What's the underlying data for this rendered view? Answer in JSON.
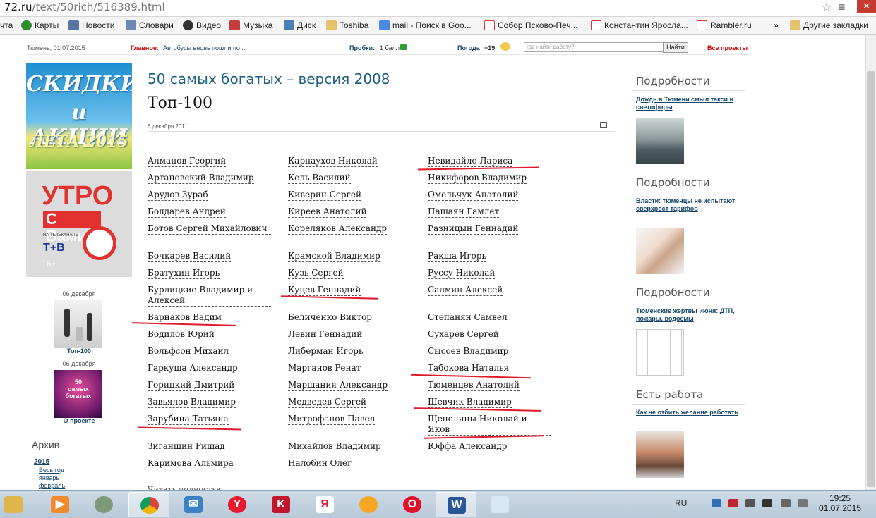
{
  "browser": {
    "url_host": "72.ru",
    "url_path": "/text/50rich/516389.html",
    "bookmarks": [
      {
        "label": "чта",
        "icon": "none"
      },
      {
        "label": "Карты",
        "icon": "maps-icon"
      },
      {
        "label": "Новости",
        "icon": "news-icon"
      },
      {
        "label": "Словари",
        "icon": "dictionary-icon"
      },
      {
        "label": "Видео",
        "icon": "video-icon"
      },
      {
        "label": "Музыка",
        "icon": "music-icon"
      },
      {
        "label": "Диск",
        "icon": "disk-icon"
      },
      {
        "label": "Toshiba",
        "icon": "folder-icon"
      },
      {
        "label": "mail - Поиск в Goo...",
        "icon": "google-icon"
      },
      {
        "label": "Собор Псково-Печ...",
        "icon": "yandex-icon"
      },
      {
        "label": "Константин Яросла...",
        "icon": "yandex-icon"
      },
      {
        "label": "Rambler.ru",
        "icon": "yandex-icon"
      },
      {
        "label": "»",
        "icon": "none"
      },
      {
        "label": "Другие закладки",
        "icon": "folder-icon"
      }
    ]
  },
  "topstrip": {
    "location_date": "Тюмень, 01.07.2015",
    "main_label": "Главное:",
    "main_link": "Автобусы вновь пошли по ...",
    "traffic_label": "Пробки:",
    "traffic_value": "1 балл",
    "weather_label": "Погода",
    "weather_value": "+19",
    "search_placeholder": "где найти работу?",
    "search_button": "Найти",
    "all_projects": "Все проекты"
  },
  "left": {
    "ad1_lines": [
      "СКИДКИ",
      "и АКЦИИ",
      "ЛЕТА 2015"
    ],
    "ad2_big": "УТРО",
    "ad2_vami": "С Вами",
    "ad2_tv": "НА ТЕЛЕКАНАЛЕ",
    "ad2_age": "16+",
    "item1_date": "06 декабря",
    "item1_link": "Топ-100",
    "item2_date": "06 декабря",
    "item2_link": "О проекте",
    "archive_title": "Архив",
    "archive_year": "2015",
    "archive_items": [
      "Весь год",
      "январь",
      "февраль"
    ]
  },
  "main": {
    "kicker": "50 самых богатых – версия 2008",
    "title": "Топ-100",
    "date": "6 декабря 2011",
    "read_full": "Читать полностью",
    "columns": [
      [
        "Алманов Георгий",
        "Артановский Владимир",
        "Арудов Зураб",
        "Болдарев Андрей",
        "Ботов Сергей Михайлович",
        "Бочкарев Василий",
        "Братухин Игорь",
        "Бурлицкие Владимир и Алексей",
        "Варнаков Вадим",
        "Водилов Юрий",
        "Вольфсон Михаил",
        "Гаркуша Александр",
        "Горицкий Дмитрий",
        "Завьялов Владимир",
        "Зарубина Татьяна",
        "Зиганшин Ришад",
        "Каримова Альмира"
      ],
      [
        "Карнаухов Николай",
        "Кель Василий",
        "Киверин Сергей",
        "Киреев Анатолий",
        "Кореляков Александр",
        "Крамской Владимир",
        "Кузь Сергей",
        "Куцев Геннадий",
        "Беличенко Виктор",
        "Левин Геннадий",
        "Либерман Игорь",
        "Марганов Ренат",
        "Маршания Александр",
        "Медведев Сергей",
        "Митрофанов Павел",
        "Михайлов Владимир",
        "Налобин Олег"
      ],
      [
        "Невидайло Лариса",
        "Никифоров Владимир",
        "Омельчук Анатолий",
        "Пашаян Гамлет",
        "Разницын Геннадий",
        "Ракша Игорь",
        "Руссу Николай",
        "Салмин Алексей",
        "Степанян Самвел",
        "Сухарев Сергей",
        "Сысоев Владимир",
        "Табокова Наталья",
        "Тюменцев Анатолий",
        "Шевчик Владимир",
        "Щепелины Николай и Яков",
        "Юффа Александр"
      ]
    ]
  },
  "right": {
    "blocks": [
      {
        "heading": "Подробности",
        "link": "Дождь в Тюмени смыл такси и светофоры"
      },
      {
        "heading": "Подробности",
        "link": "Власти: тюменцы не испытают сверхрост тарифов"
      },
      {
        "heading": "Подробности",
        "link": "Тюменские жертвы июня: ДТП, пожары, водоемы"
      },
      {
        "heading": "Есть работа",
        "link": "Как не отбить желание работать"
      }
    ]
  },
  "taskbar": {
    "lang": "RU",
    "time": "19:25",
    "date": "01.07.2015",
    "apps": [
      "file-explorer-icon",
      "media-player-icon",
      "webcam-icon",
      "chrome-icon",
      "mail-icon",
      "yandex-browser-icon",
      "kaspersky-icon",
      "yandex-icon",
      "odnoklassniki-icon",
      "opera-icon",
      "word-icon",
      "paint-icon"
    ]
  },
  "colors": {
    "link": "#14456b",
    "kicker": "#1f5e85",
    "highlight_red": "#e0192b",
    "alert_red": "#cc0000"
  }
}
